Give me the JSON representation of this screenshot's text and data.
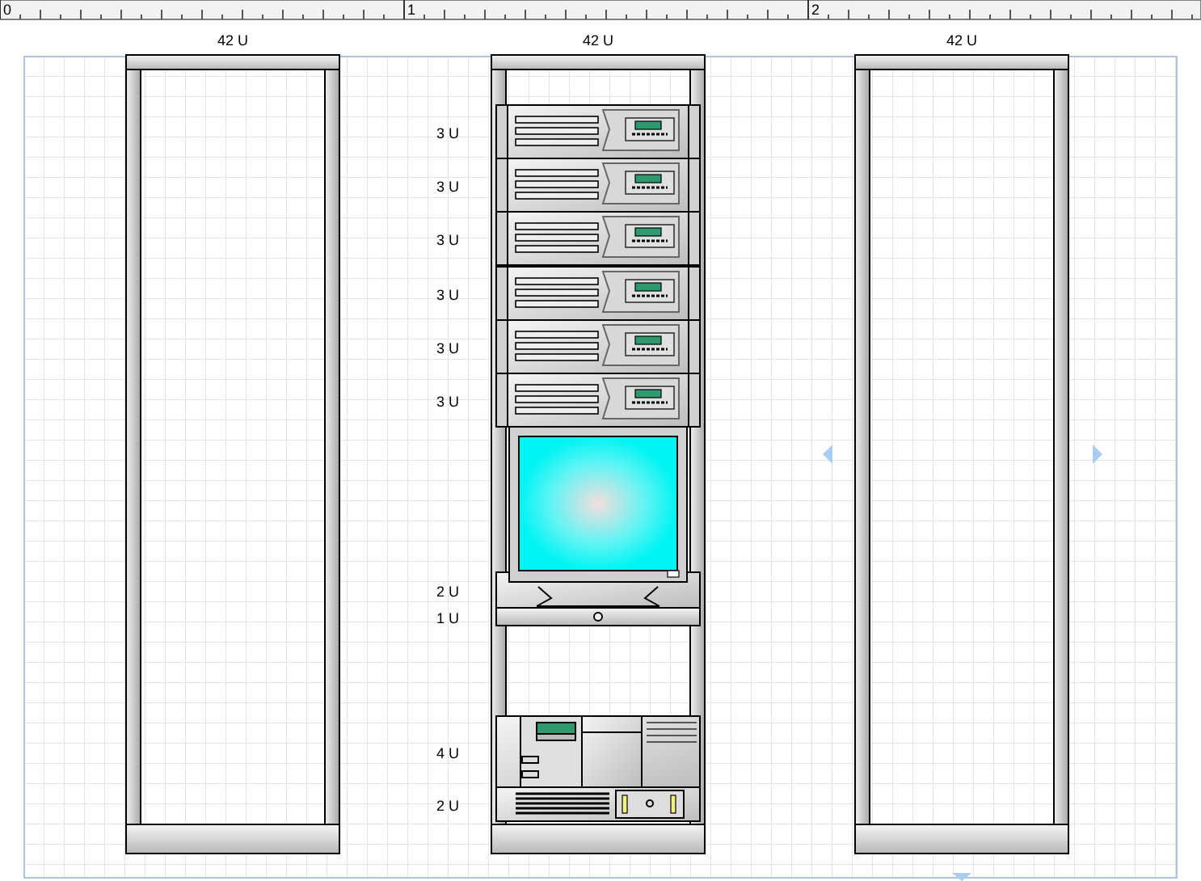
{
  "ruler": {
    "labels": [
      "0",
      "1",
      "2"
    ]
  },
  "racks": [
    {
      "capacity": "42 U"
    },
    {
      "capacity": "42 U",
      "devices": [
        {
          "kind": "server",
          "units": "3 U"
        },
        {
          "kind": "server",
          "units": "3 U"
        },
        {
          "kind": "server",
          "units": "3 U"
        },
        {
          "kind": "server",
          "units": "3 U"
        },
        {
          "kind": "server",
          "units": "3 U"
        },
        {
          "kind": "server",
          "units": "3 U"
        },
        {
          "kind": "monitor",
          "units": "2 U"
        },
        {
          "kind": "drawer",
          "units": "1 U"
        },
        {
          "kind": "storage",
          "units": "4 U"
        },
        {
          "kind": "power",
          "units": "2 U"
        }
      ]
    },
    {
      "capacity": "42 U"
    }
  ]
}
